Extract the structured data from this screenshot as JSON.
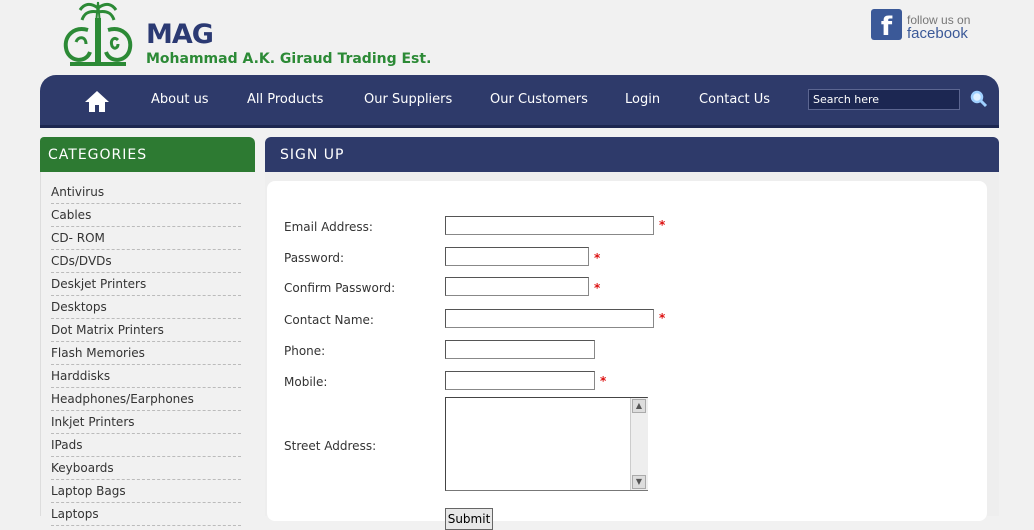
{
  "header": {
    "brand_short": "MAG",
    "brand_full": "Mohammad A.K. Giraud Trading Est.",
    "facebook_follow": "follow us on",
    "facebook_name": "facebook",
    "facebook_letter": "f"
  },
  "nav": {
    "items": [
      "About us",
      "All Products",
      "Our Suppliers",
      "Our Customers",
      "Login",
      "Contact Us"
    ],
    "search_placeholder": "Search here"
  },
  "sidebar": {
    "title": "CATEGORIES",
    "items": [
      "Antivirus",
      "Cables",
      "CD- ROM",
      "CDs/DVDs",
      "Deskjet Printers",
      "Desktops",
      "Dot Matrix Printers",
      "Flash Memories",
      "Harddisks",
      "Headphones/Earphones",
      "Inkjet Printers",
      "IPads",
      "Keyboards",
      "Laptop Bags",
      "Laptops"
    ]
  },
  "form": {
    "title": "SIGN UP",
    "email_label": "Email Address:",
    "password_label": "Password:",
    "confirm_label": "Confirm Password:",
    "contact_label": "Contact Name:",
    "phone_label": "Phone:",
    "mobile_label": "Mobile:",
    "street_label": "Street Address:",
    "required_mark": "*",
    "submit_label": "Submit"
  },
  "colors": {
    "nav_bg": "#2e3a6a",
    "category_bg": "#2d7a32",
    "brand_green": "#2c8a36",
    "required": "#d11111"
  }
}
